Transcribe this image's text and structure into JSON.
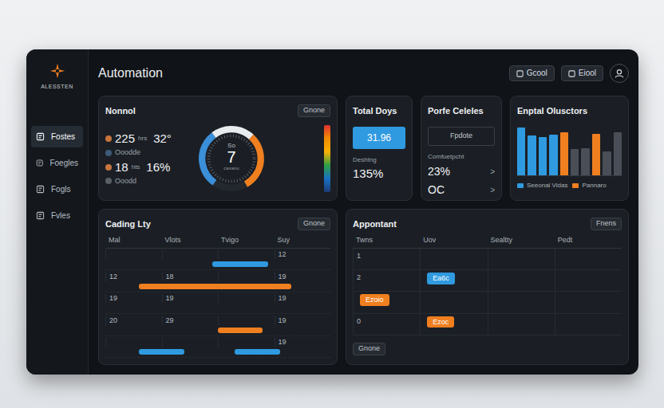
{
  "logo": {
    "text": "ALESSTEN"
  },
  "header": {
    "title": "Automation",
    "buttons": [
      "Gcool",
      "Eiool"
    ]
  },
  "sidebar": {
    "items": [
      {
        "label": "Fostes",
        "selected": true
      },
      {
        "label": "Foegles",
        "selected": false
      },
      {
        "label": "Fogls",
        "selected": false
      },
      {
        "label": "Fvles",
        "selected": false
      }
    ]
  },
  "overview": {
    "title": "Nonnol",
    "button": "Gnone",
    "stats": [
      {
        "kind": "figure",
        "value": "225",
        "unit": "hrs",
        "extra": "32°",
        "color": "#c8743e"
      },
      {
        "kind": "note",
        "label": "Ooodde",
        "color": "#3d5a78"
      },
      {
        "kind": "figure",
        "value": "18",
        "unit": "hts",
        "extra": "16%",
        "color": "#c8743e"
      },
      {
        "kind": "note",
        "label": "Ooodd",
        "color": "#5a5f66"
      }
    ],
    "gauge": {
      "top": "So",
      "value": "7",
      "caption": "caxanu",
      "segments": [
        {
          "level": 0.3,
          "color": "#3b8fd9"
        },
        {
          "level": 0.22,
          "color": "#e9ecef"
        },
        {
          "level": 0.3,
          "color": "#f07f1f"
        }
      ]
    }
  },
  "total_days": {
    "title": "Total Doys",
    "value": "31.96",
    "label": "Deshtng",
    "figure": "135%"
  },
  "profile": {
    "title": "Porfe Celeles",
    "button": "Fpdote",
    "label": "Comfuetpcht",
    "rows": [
      {
        "text": "23%",
        "arrow": ">"
      },
      {
        "text": "OC",
        "arrow": ">"
      }
    ]
  },
  "chart": {
    "title": "Enptal Olusctors",
    "bars": [
      {
        "value": 8.5,
        "color": "#2f9ae0"
      },
      {
        "value": 7,
        "color": "#2f9ae0"
      },
      {
        "value": 6.8,
        "color": "#2f9ae0"
      },
      {
        "value": 7.2,
        "color": "#2f9ae0"
      },
      {
        "value": 7.6,
        "color": "#f07f1f"
      },
      {
        "value": 4.6,
        "color": "#4a4f57"
      },
      {
        "value": 4.8,
        "color": "#4a4f57"
      },
      {
        "value": 7.4,
        "color": "#f07f1f"
      },
      {
        "value": 4.2,
        "color": "#4a4f57"
      },
      {
        "value": 7.6,
        "color": "#4a4f57"
      }
    ],
    "legend": [
      {
        "label": "Seeonal Vidas",
        "color": "#2f9ae0"
      },
      {
        "label": "Pannaro",
        "color": "#f07f1f"
      }
    ]
  },
  "schedule": {
    "title": "Cading Lty",
    "button": "Gnone",
    "columns": [
      "Mal",
      "Vlots",
      "Tvigo",
      "Suy"
    ],
    "rows": [
      {
        "cells": [
          "",
          "",
          "",
          "12"
        ],
        "bars": [
          {
            "from": 1.9,
            "to": 2.9,
            "color": "#2f9ae0"
          }
        ]
      },
      {
        "cells": [
          "12",
          "18",
          "",
          "19"
        ],
        "bars": [
          {
            "from": 0.6,
            "to": 3.3,
            "color": "#f07f1f"
          }
        ]
      },
      {
        "cells": [
          "19",
          "19",
          "",
          "19"
        ],
        "bars": []
      },
      {
        "cells": [
          "20",
          "29",
          "",
          "19"
        ],
        "bars": [
          {
            "from": 2.0,
            "to": 2.8,
            "color": "#f07f1f"
          }
        ]
      },
      {
        "cells": [
          "",
          "",
          "",
          "19"
        ],
        "bars": [
          {
            "from": 0.6,
            "to": 1.4,
            "color": "#2f9ae0"
          },
          {
            "from": 2.3,
            "to": 3.1,
            "color": "#2f9ae0"
          }
        ]
      }
    ]
  },
  "appointments": {
    "title": "Appontant",
    "button": "Fnens",
    "columns": [
      "Twns",
      "Uov",
      "Sealtty",
      "Pedt"
    ],
    "rows": [
      {
        "cells": [
          "1",
          "",
          "",
          ""
        ]
      },
      {
        "cells": [
          "2",
          "",
          "",
          ""
        ]
      },
      {
        "cells": [
          "",
          "",
          "",
          ""
        ]
      },
      {
        "cells": [
          "0",
          "",
          "",
          ""
        ]
      }
    ],
    "events": [
      {
        "text": "Ea6c",
        "row": 1,
        "col": 1,
        "color": "#2f9ae0"
      },
      {
        "text": "Ezoio",
        "row": 2,
        "col": 0,
        "color": "#f07f1f"
      },
      {
        "text": "Ezoc",
        "row": 3,
        "col": 1,
        "color": "#f07f1f"
      }
    ],
    "footer_button": "Gnone"
  }
}
